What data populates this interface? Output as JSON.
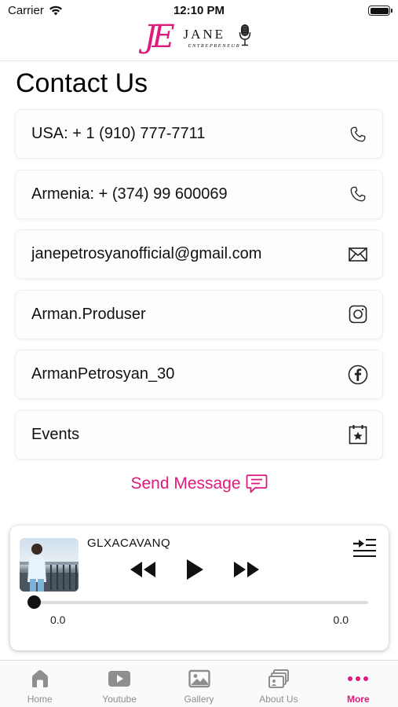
{
  "status_bar": {
    "carrier": "Carrier",
    "time": "12:10 PM"
  },
  "logo": {
    "initials": "JE",
    "name": "JANE",
    "tagline": "ENTREPRENEUR"
  },
  "page": {
    "title": "Contact Us"
  },
  "contacts": [
    {
      "label": "USA: + 1 (910) 777-7711",
      "icon": "phone-icon"
    },
    {
      "label": "Armenia: + (374) 99 600069",
      "icon": "phone-icon"
    },
    {
      "label": "janepetrosyanofficial@gmail.com",
      "icon": "mail-icon"
    },
    {
      "label": "Arman.Produser",
      "icon": "instagram-icon"
    },
    {
      "label": "ArmanPetrosyan_30",
      "icon": "facebook-icon"
    },
    {
      "label": "Events",
      "icon": "calendar-star-icon"
    }
  ],
  "send_message": {
    "label": "Send Message",
    "icon": "message-icon"
  },
  "player": {
    "track_title": "GLXACAVANQ",
    "time_elapsed": "0.0",
    "time_total": "0.0",
    "progress": 0
  },
  "tabs": [
    {
      "label": "Home",
      "icon": "home-icon",
      "active": false
    },
    {
      "label": "Youtube",
      "icon": "youtube-icon",
      "active": false
    },
    {
      "label": "Gallery",
      "icon": "gallery-icon",
      "active": false
    },
    {
      "label": "About Us",
      "icon": "about-icon",
      "active": false
    },
    {
      "label": "More",
      "icon": "more-icon",
      "active": true
    }
  ],
  "colors": {
    "accent": "#e0197d",
    "tab_inactive": "#8e8e8e"
  }
}
